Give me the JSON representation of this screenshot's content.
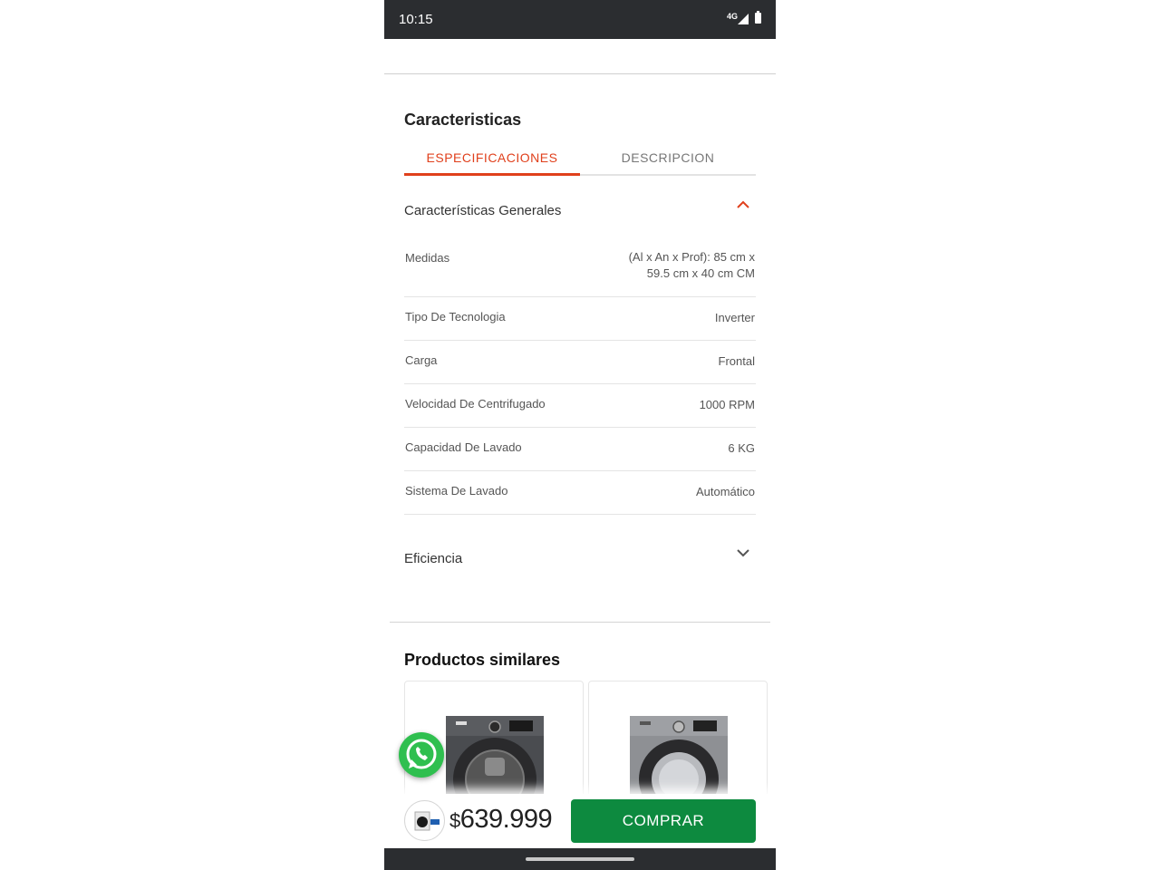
{
  "status_bar": {
    "time": "10:15",
    "network": "4G"
  },
  "characteristics": {
    "title": "Caracteristicas",
    "tabs": [
      {
        "label": "ESPECIFICACIONES",
        "active": true
      },
      {
        "label": "DESCRIPCION",
        "active": false
      }
    ],
    "groups": [
      {
        "label": "Características Generales",
        "expanded": true,
        "rows": [
          {
            "key": "Medidas",
            "value_line1": "(Al x An x Prof): 85 cm x",
            "value_line2": "59.5 cm x 40 cm CM"
          },
          {
            "key": "Tipo De Tecnologia",
            "value": "Inverter"
          },
          {
            "key": "Carga",
            "value": "Frontal"
          },
          {
            "key": "Velocidad De Centrifugado",
            "value": "1000 RPM"
          },
          {
            "key": "Capacidad De Lavado",
            "value": "6 KG"
          },
          {
            "key": "Sistema De Lavado",
            "value": "Automático"
          }
        ]
      },
      {
        "label": "Eficiencia",
        "expanded": false
      }
    ]
  },
  "similar": {
    "title": "Productos similares"
  },
  "bottom_bar": {
    "currency": "$",
    "price": "639.999",
    "buy_label": "COMPRAR"
  },
  "colors": {
    "accent": "#e0401c",
    "buy_button": "#0d8a3f",
    "whatsapp": "#2fbf4f"
  }
}
